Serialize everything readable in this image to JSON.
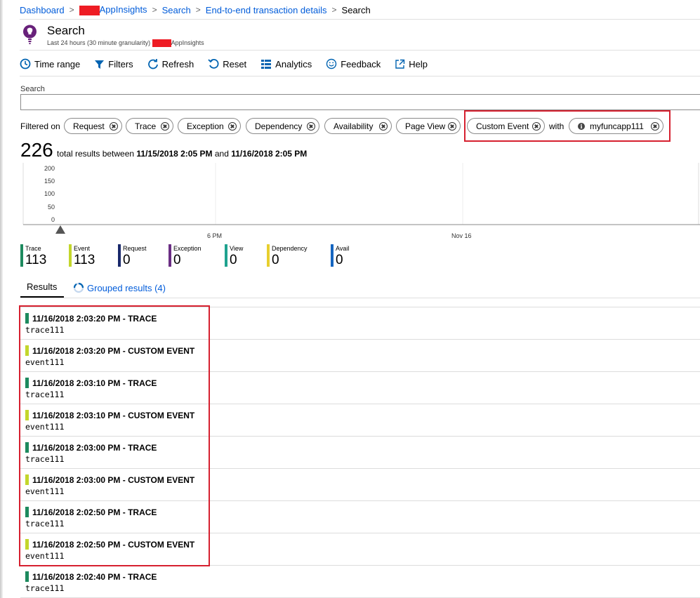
{
  "breadcrumb": {
    "items": [
      "Dashboard",
      "AppInsights",
      "Search",
      "End-to-end transaction details"
    ],
    "current": "Search"
  },
  "header": {
    "title": "Search",
    "subtitle_prefix": "Last 24 hours (30 minute granularity)",
    "subtitle_suffix": "AppInsights"
  },
  "toolbar": {
    "time_range": "Time range",
    "filters": "Filters",
    "refresh": "Refresh",
    "reset": "Reset",
    "analytics": "Analytics",
    "feedback": "Feedback",
    "help": "Help"
  },
  "search": {
    "label": "Search",
    "value": ""
  },
  "filters": {
    "label": "Filtered on",
    "chips": [
      "Request",
      "Trace",
      "Exception",
      "Dependency",
      "Availability",
      "Page View",
      "Custom Event"
    ],
    "with_label": "with",
    "with_value": "myfuncapp111"
  },
  "totals": {
    "count": "226",
    "text_prefix": "total results between",
    "start": "11/15/2018 2:05 PM",
    "and": "and",
    "end": "11/16/2018 2:05 PM"
  },
  "chart_data": {
    "type": "bar",
    "y_ticks": [
      "200",
      "150",
      "100",
      "50",
      "0"
    ],
    "x_ticks": [
      "6 PM",
      "Nov 16"
    ],
    "ylim": [
      0,
      200
    ],
    "grid": true
  },
  "legend": [
    {
      "name": "Trace",
      "value": "113",
      "color": "#1d8a5e"
    },
    {
      "name": "Event",
      "value": "113",
      "color": "#c3d62c"
    },
    {
      "name": "Request",
      "value": "0",
      "color": "#1a2a6c"
    },
    {
      "name": "Exception",
      "value": "0",
      "color": "#6b2e84"
    },
    {
      "name": "View",
      "value": "0",
      "color": "#1fa28f"
    },
    {
      "name": "Dependency",
      "value": "0",
      "color": "#e8cf2e"
    },
    {
      "name": "Avail",
      "value": "0",
      "color": "#1565c0"
    }
  ],
  "tabs": {
    "results": "Results",
    "grouped": "Grouped results (4)"
  },
  "results": [
    {
      "title": "11/16/2018 2:03:20 PM - TRACE",
      "sub": "trace111",
      "color": "#1d8a5e"
    },
    {
      "title": "11/16/2018 2:03:20 PM - CUSTOM EVENT",
      "sub": "event111",
      "color": "#c3d62c"
    },
    {
      "title": "11/16/2018 2:03:10 PM - TRACE",
      "sub": "trace111",
      "color": "#1d8a5e"
    },
    {
      "title": "11/16/2018 2:03:10 PM - CUSTOM EVENT",
      "sub": "event111",
      "color": "#c3d62c"
    },
    {
      "title": "11/16/2018 2:03:00 PM - TRACE",
      "sub": "trace111",
      "color": "#1d8a5e"
    },
    {
      "title": "11/16/2018 2:03:00 PM - CUSTOM EVENT",
      "sub": "event111",
      "color": "#c3d62c"
    },
    {
      "title": "11/16/2018 2:02:50 PM - TRACE",
      "sub": "trace111",
      "color": "#1d8a5e"
    },
    {
      "title": "11/16/2018 2:02:50 PM - CUSTOM EVENT",
      "sub": "event111",
      "color": "#c3d62c"
    },
    {
      "title": "11/16/2018 2:02:40 PM - TRACE",
      "sub": "trace111",
      "color": "#1d8a5e"
    }
  ]
}
